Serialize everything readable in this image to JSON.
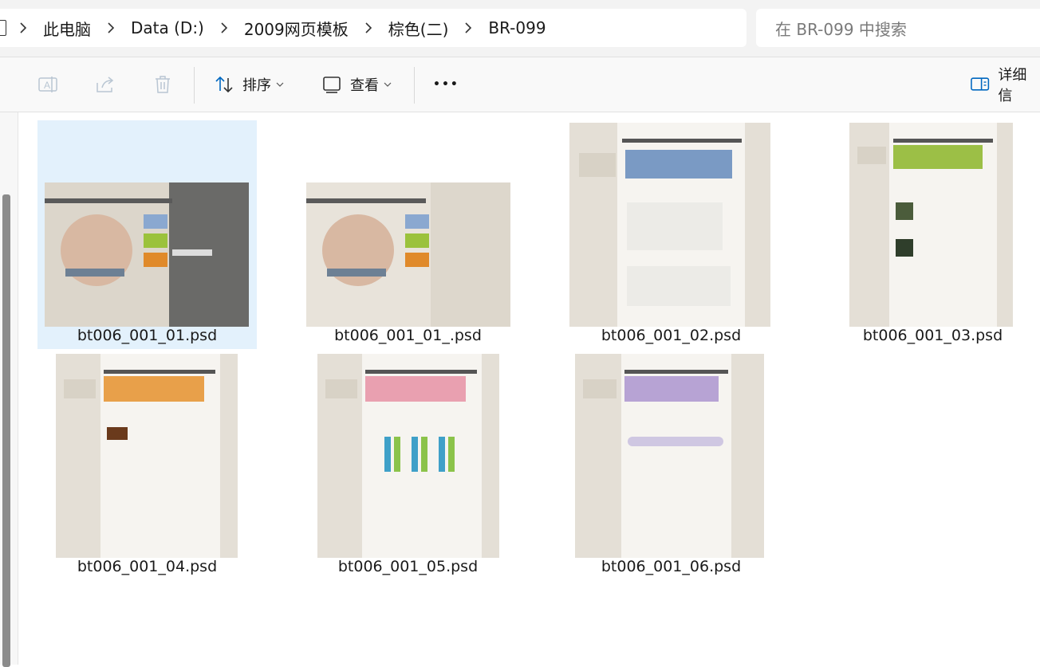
{
  "address_bar": {
    "breadcrumbs": [
      "此电脑",
      "Data (D:)",
      "2009网页模板",
      "棕色(二)",
      "BR-099"
    ]
  },
  "search": {
    "placeholder": "在 BR-099 中搜索"
  },
  "toolbar": {
    "sort_label": "排序",
    "view_label": "查看",
    "more_label": "•••",
    "details_label": "详细信"
  },
  "files": [
    {
      "name": "bt006_001_01.psd",
      "selected": true
    },
    {
      "name": "bt006_001_01_.psd",
      "selected": false
    },
    {
      "name": "bt006_001_02.psd",
      "selected": false
    },
    {
      "name": "bt006_001_03.psd",
      "selected": false
    },
    {
      "name": "bt006_001_04.psd",
      "selected": false
    },
    {
      "name": "bt006_001_05.psd",
      "selected": false
    },
    {
      "name": "bt006_001_06.psd",
      "selected": false
    }
  ],
  "colors": {
    "selection": "#e3f1fc",
    "thumb_bg": "#e9e4db",
    "accent_blue": "#0067c0"
  }
}
